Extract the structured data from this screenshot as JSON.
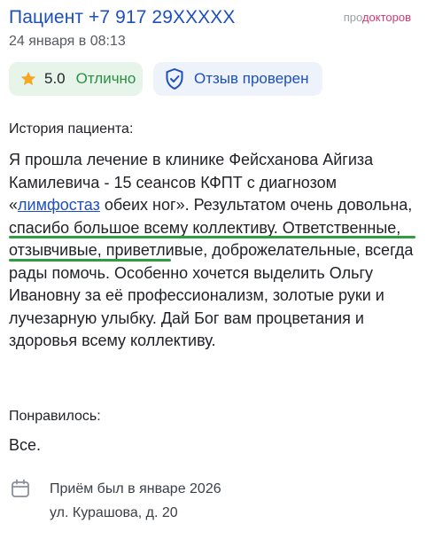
{
  "header": {
    "patient": "Пациент +7 917 29XXXXX",
    "date": "24 января в 08:13",
    "brand_pro": "про",
    "brand_rest": "докторов"
  },
  "rating": {
    "score": "5.0",
    "word": "Отлично",
    "icon": "star-icon",
    "color": "#f5a623"
  },
  "verified": {
    "label": "Отзыв проверен",
    "icon": "shield-check-icon"
  },
  "history": {
    "title": "История пациента:",
    "text_before_link": "Я прошла лечение в клинике Фейсханова Айгиза Камилевича - 15 сеансов КФПТ с диагнозом «",
    "link": "лимфостаз",
    "text_after_link": " обеих ног». Результатом очень довольна, спасибо большое всему коллективу. Ответственные, отзывчивые, приветливые, доброжелательные, всегда рады помочь. Особенно хочется выделить Ольгу Ивановну за её профессионализм, золотые руки и лучезарную улыбку. Дай Бог вам процветания и здоровья всему коллективу."
  },
  "liked": {
    "title": "Понравилось:",
    "text": "Все."
  },
  "visit": {
    "icon": "calendar-icon",
    "when": "Приём был в январе 2026",
    "address": "ул. Курашова, д. 20"
  },
  "colors": {
    "accent": "#1d4fbf",
    "green": "#2e8e44",
    "highlight": "#2e9e3e",
    "brand": "#cf3a73"
  }
}
